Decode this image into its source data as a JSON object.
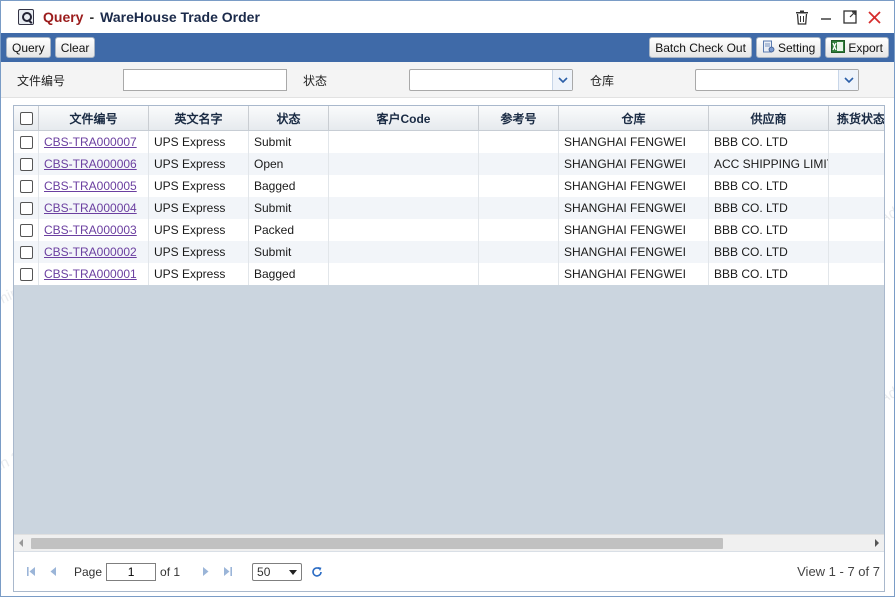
{
  "title": {
    "query": "Query",
    "separator": "-",
    "main": "WareHouse Trade Order"
  },
  "toolbar": {
    "query": "Query",
    "clear": "Clear",
    "batch_check_out": "Batch Check Out",
    "setting": "Setting",
    "export": "Export"
  },
  "filters": {
    "doc_no_label": "文件编号",
    "doc_no_value": "",
    "status_label": "状态",
    "status_value": "",
    "warehouse_label": "仓库",
    "warehouse_value": ""
  },
  "grid": {
    "columns": [
      "文件编号",
      "英文名字",
      "状态",
      "客户Code",
      "参考号",
      "仓库",
      "供应商",
      "拣货状态"
    ],
    "rows": [
      [
        "CBS-TRA000007",
        "UPS Express",
        "Submit",
        "",
        "",
        "SHANGHAI FENGWEI",
        "BBB CO. LTD",
        ""
      ],
      [
        "CBS-TRA000006",
        "UPS Express",
        "Open",
        "",
        "",
        "SHANGHAI FENGWEI",
        "ACC SHIPPING LIMITED",
        ""
      ],
      [
        "CBS-TRA000005",
        "UPS Express",
        "Bagged",
        "",
        "",
        "SHANGHAI FENGWEI",
        "BBB CO. LTD",
        ""
      ],
      [
        "CBS-TRA000004",
        "UPS Express",
        "Submit",
        "",
        "",
        "SHANGHAI FENGWEI",
        "BBB CO. LTD",
        ""
      ],
      [
        "CBS-TRA000003",
        "UPS Express",
        "Packed",
        "",
        "",
        "SHANGHAI FENGWEI",
        "BBB CO. LTD",
        ""
      ],
      [
        "CBS-TRA000002",
        "UPS Express",
        "Submit",
        "",
        "",
        "SHANGHAI FENGWEI",
        "BBB CO. LTD",
        ""
      ],
      [
        "CBS-TRA000001",
        "UPS Express",
        "Bagged",
        "",
        "",
        "SHANGHAI FENGWEI",
        "BBB CO. LTD",
        ""
      ]
    ]
  },
  "pager": {
    "page_label": "Page",
    "page_value": "1",
    "of_label": "of 1",
    "page_size": "50",
    "info": "View 1 - 7 of 7"
  },
  "watermark": "TLKA.CBS.Admin 2024-05-30"
}
